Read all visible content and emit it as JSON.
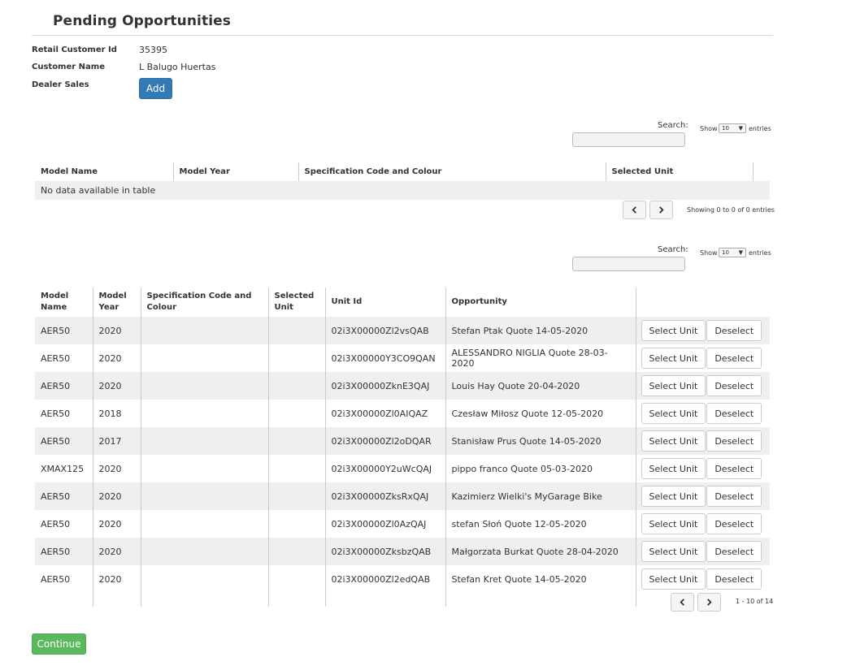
{
  "page": {
    "title": "Pending Opportunities"
  },
  "info": {
    "retail_customer_id_label": "Retail Customer Id",
    "retail_customer_id": "35395",
    "customer_name_label": "Customer Name",
    "customer_name": "L Balugo Huertas",
    "dealer_sales_label": "Dealer Sales",
    "add_label": "Add"
  },
  "table1": {
    "search_label": "Search:",
    "show_label": "Show",
    "page_size": "10",
    "entries_label": "entries",
    "headers": [
      "Model Name",
      "Model Year",
      "Specification Code and Colour",
      "Selected Unit"
    ],
    "empty_text": "No data available in table",
    "info": "Showing 0 to 0 of 0 entries"
  },
  "table2": {
    "search_label": "Search:",
    "show_label": "Show",
    "page_size": "10",
    "entries_label": "entries",
    "headers": {
      "model_name": "Model Name",
      "model_year": "Model Year",
      "spec": "Specification Code and Colour",
      "selected_unit": "Selected Unit",
      "unit_id": "Unit Id",
      "opportunity": "Opportunity"
    },
    "select_label": "Select Unit",
    "deselect_label": "Deselect",
    "rows": [
      {
        "model": "AER50",
        "year": "2020",
        "spec": "",
        "selected": "",
        "unit_id": "02i3X00000Zl2vsQAB",
        "opportunity": "Stefan Ptak Quote 14-05-2020"
      },
      {
        "model": "AER50",
        "year": "2020",
        "spec": "",
        "selected": "",
        "unit_id": "02i3X00000Y3CO9QAN",
        "opportunity": "ALESSANDRO NIGLIA Quote 28-03-2020"
      },
      {
        "model": "AER50",
        "year": "2020",
        "spec": "",
        "selected": "",
        "unit_id": "02i3X00000ZknE3QAJ",
        "opportunity": "Louis Hay Quote 20-04-2020"
      },
      {
        "model": "AER50",
        "year": "2018",
        "spec": "",
        "selected": "",
        "unit_id": "02i3X00000Zl0AIQAZ",
        "opportunity": "Czesław Miłosz Quote 12-05-2020"
      },
      {
        "model": "AER50",
        "year": "2017",
        "spec": "",
        "selected": "",
        "unit_id": "02i3X00000Zl2oDQAR",
        "opportunity": "Stanisław Prus Quote 14-05-2020"
      },
      {
        "model": "XMAX125",
        "year": "2020",
        "spec": "",
        "selected": "",
        "unit_id": "02i3X00000Y2uWcQAJ",
        "opportunity": "pippo franco Quote 05-03-2020"
      },
      {
        "model": "AER50",
        "year": "2020",
        "spec": "",
        "selected": "",
        "unit_id": "02i3X00000ZksRxQAJ",
        "opportunity": "Kazimierz Wielki's MyGarage Bike"
      },
      {
        "model": "AER50",
        "year": "2020",
        "spec": "",
        "selected": "",
        "unit_id": "02i3X00000Zl0AzQAJ",
        "opportunity": "stefan Słoń Quote 12-05-2020"
      },
      {
        "model": "AER50",
        "year": "2020",
        "spec": "",
        "selected": "",
        "unit_id": "02i3X00000ZksbzQAB",
        "opportunity": "Małgorzata Burkat Quote 28-04-2020"
      },
      {
        "model": "AER50",
        "year": "2020",
        "spec": "",
        "selected": "",
        "unit_id": "02i3X00000Zl2edQAB",
        "opportunity": "Stefan Kret Quote 14-05-2020"
      }
    ],
    "info": "1 - 10 of 14"
  },
  "footer": {
    "continue_label": "Continue"
  },
  "icons": {
    "prev": "chevron-left-icon",
    "next": "chevron-right-icon",
    "dropdown": "caret-down-icon"
  },
  "colors": {
    "primary": "#337ab7",
    "success": "#5cb85c",
    "stripe": "#efefef"
  }
}
